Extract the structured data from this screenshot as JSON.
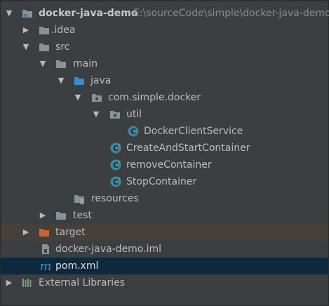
{
  "tree": {
    "root": {
      "name": "docker-java-demo",
      "path": "E:\\sourceCode\\simple\\docker-java-demo"
    },
    "idea": "idea",
    "src": "src",
    "main": "main",
    "java": "java",
    "package": "com.simple.docker",
    "util": "util",
    "classes": {
      "docker_client_service": "DockerClientService",
      "create_and_start_container": "CreateAndStartContainer",
      "remove_container": "removeContainer",
      "stop_container": "StopContainer"
    },
    "resources": "resources",
    "test": "test",
    "target": "target",
    "iml_file": "docker-java-demo.iml",
    "pom_file": "pom.xml",
    "external_libraries": "External Libraries",
    "selected_item": "pom.xml",
    "highlighted_item": "target"
  },
  "icons": {
    "expanded": "chevron-down-icon",
    "collapsed": "chevron-right-icon",
    "module": "module-folder-icon",
    "folder": "folder-icon",
    "source_root": "source-root-folder-icon",
    "package": "package-icon",
    "class": "java-class-icon",
    "resources": "resources-folder-icon",
    "excluded": "excluded-folder-icon",
    "iml": "iml-file-icon",
    "maven": "maven-pom-icon",
    "libraries": "libraries-icon"
  },
  "colors": {
    "panel_bg": "#3c3f41",
    "selected_row": "#0d293e",
    "target_row": "#45403b",
    "folder": "#87939a",
    "source_folder": "#3d8bcd",
    "excluded_folder": "#c9662e",
    "class_icon": "#3e86a0",
    "text": "#bbbbbb"
  }
}
